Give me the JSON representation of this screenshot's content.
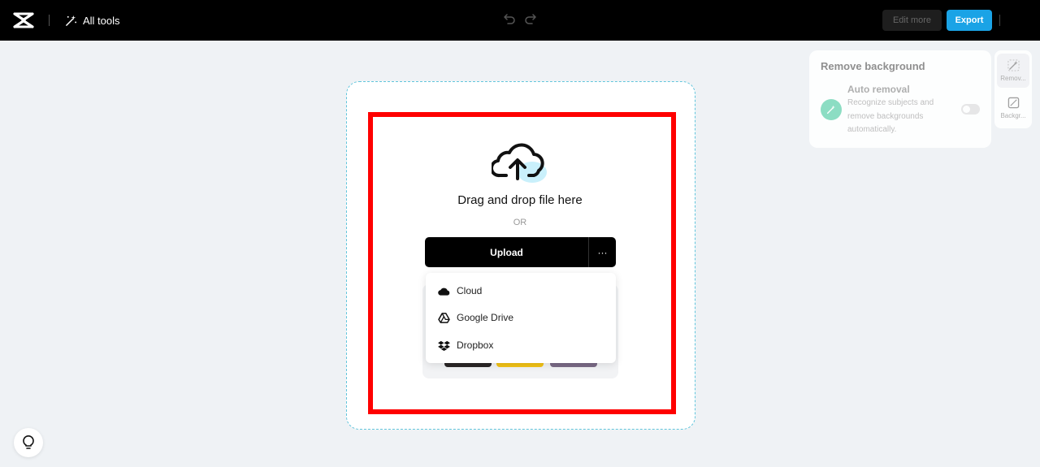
{
  "topbar": {
    "all_tools_label": "All tools",
    "edit_more_label": "Edit more",
    "export_label": "Export"
  },
  "upload": {
    "drag_text": "Drag and drop file here",
    "or_text": "OR",
    "upload_label": "Upload",
    "more_label": "···",
    "menu": [
      {
        "label": "Cloud",
        "icon": "cloud-icon"
      },
      {
        "label": "Google Drive",
        "icon": "google-drive-icon"
      },
      {
        "label": "Dropbox",
        "icon": "dropbox-icon"
      }
    ]
  },
  "panel": {
    "title": "Remove background",
    "auto_removal_title": "Auto removal",
    "auto_removal_desc": "Recognize subjects and remove backgrounds automatically.",
    "toggle_on": false
  },
  "side_tools": [
    {
      "label": "Remov...",
      "icon": "remove-bg-icon"
    },
    {
      "label": "Backgr...",
      "icon": "background-icon"
    }
  ],
  "colors": {
    "accent": "#1aa3e6",
    "highlight": "#ff0000",
    "dashed_border": "#62c5dc"
  }
}
